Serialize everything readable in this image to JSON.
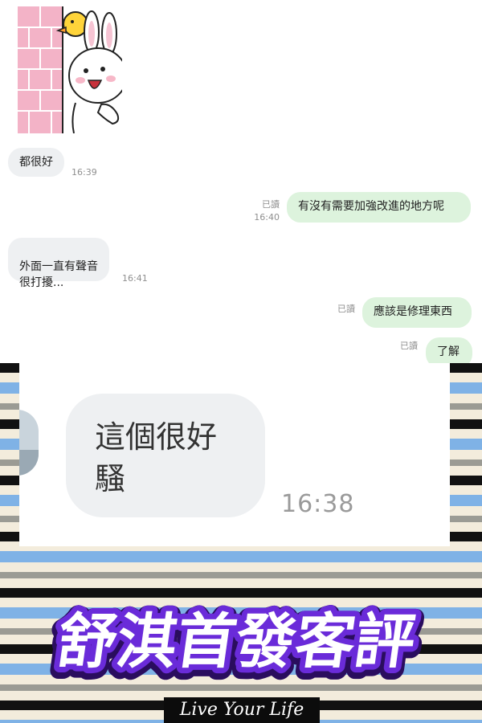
{
  "messages": [
    {
      "direction": "in",
      "text": "都很好",
      "time": "16:39"
    },
    {
      "direction": "out",
      "text": "有沒有需要加強改進的地方呢",
      "read": "已讀",
      "time": "16:40"
    },
    {
      "direction": "in",
      "text": "外面一直有聲音\n很打擾...",
      "time": "16:41"
    },
    {
      "direction": "out",
      "text": "應該是修理東西",
      "read": "已讀"
    },
    {
      "direction": "out",
      "text": "了解",
      "read": "已讀"
    }
  ],
  "sticker": {
    "icon": "bunny-peek-sticker"
  },
  "zoomed_message": {
    "text": "這個很好\n騷",
    "time": "16:38"
  },
  "banner": {
    "title": "舒淇首發客評",
    "tagline": "Live Your Life"
  },
  "colors": {
    "incoming_bubble": "#eef0f2",
    "outgoing_bubble": "#ddf3dd",
    "title_fill": "#ffffff",
    "title_outline": "#6a2bd9",
    "stripe_blue": "#7fb2e6",
    "stripe_black": "#111111",
    "stripe_cream": "#f3ecdc"
  }
}
